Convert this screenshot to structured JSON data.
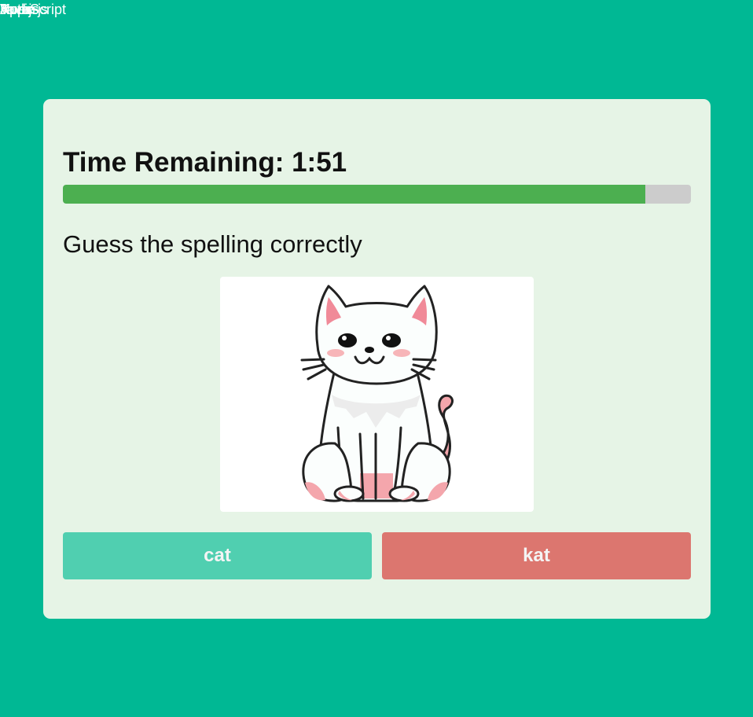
{
  "page": {
    "overlapping_labels": [
      "JavaScript",
      "Vue.js",
      "Node.js",
      "Kotlin",
      "Apps"
    ]
  },
  "quiz": {
    "timer_label": "Time Remaining:",
    "timer_value": "1:51",
    "progress_fraction": 0.927,
    "prompt": "Guess the spelling correctly",
    "image_subject": "cat-illustration",
    "options": [
      "cat",
      "kat"
    ]
  },
  "colors": {
    "background": "#00b894",
    "card": "#e6f4e6",
    "progress_fill": "#4caf50",
    "progress_track": "#cccccc",
    "option_a": "#50cfb0",
    "option_b": "#dc766f"
  }
}
